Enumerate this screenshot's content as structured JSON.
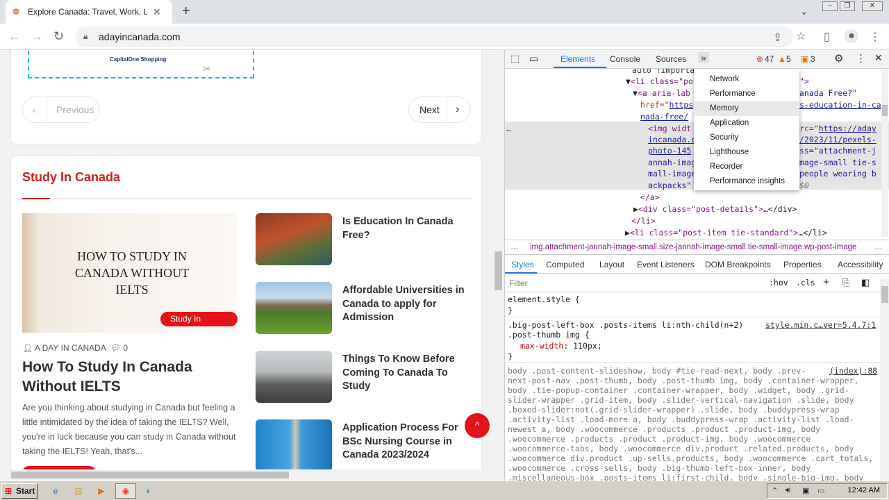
{
  "browser": {
    "tab_title": "Explore Canada: Travel, Work, Live,",
    "tab_close": "✕",
    "new_tab": "+",
    "url": "adayincanada.com"
  },
  "page": {
    "ad_text": "CapitalOne Shopping",
    "pager": {
      "previous": "Previous",
      "next": "Next"
    },
    "section_title": "Study In Canada",
    "featured": {
      "image_text_lines": [
        "HOW TO STUDY IN",
        "CANADA WITHOUT",
        "IELTS"
      ],
      "category_badge": "Study In Canada",
      "author": "A DAY IN CANADA",
      "comments": "0",
      "title": "How To Study In Canada Without IELTS",
      "excerpt": "Are you thinking about studying in Canada but feeling a little intimidated by the idea of taking the IELTS? Well, you're in luck because you can study in Canada without taking the IELTS! Yeah, that's..."
    },
    "posts": [
      {
        "title": "Is Education In Canada Free?"
      },
      {
        "title": "Affordable Universities in Canada to apply for Admission"
      },
      {
        "title": "Things To Know Before Coming To Canada To Study"
      },
      {
        "title": "Application Process For BSc Nursing Course in Canada 2023/2024"
      }
    ]
  },
  "devtools": {
    "tabs": [
      "Elements",
      "Console",
      "Sources"
    ],
    "errors": "47",
    "warnings": "5",
    "issues": "3",
    "overflow_menu": [
      "Network",
      "Performance",
      "Memory",
      "Application",
      "Security",
      "Lighthouse",
      "Recorder",
      "Performance insights"
    ],
    "dom_lines": {
      "l0": "auto !importa",
      "l1a": "<li class=\"po",
      "l1b": "\">",
      "l2a": "<a aria-lab",
      "l2b": "anada Free?\"",
      "l3a": "href=\"",
      "l3b": "https",
      "l3c": "s-education-in-ca",
      "l4": "nada-free/",
      "l5a": "<img widt",
      "l5b": "rc=\"",
      "l5c": "https://aday",
      "l6a": "incanada.c",
      "l6b": "/2023/11/pexels-",
      "l7a": "photo-145",
      "l7b": "ss=\"attachment-j",
      "l8a": "annah-imag",
      "l8b": "mage-small tie-s",
      "l9a": "mall-image",
      "l9b": "people wearing b",
      "l10a": "ackpacks\"",
      "l10b": "$0",
      "l11": "</a>",
      "l12a": "<div class=\"post-details\">",
      "l12b": "…</div>",
      "l13": "</li>",
      "l14a": "<li class=\"post-item  tie-standard\">",
      "l14b": "…</li>"
    },
    "breadcrumb": "img.attachment-jannah-image-small.size-jannah-image-small.tie-small-image.wp-post-image",
    "style_tabs": [
      "Styles",
      "Computed",
      "Layout",
      "Event Listeners",
      "DOM Breakpoints",
      "Properties",
      "Accessibility"
    ],
    "filter_placeholder": "Filter",
    "hov": ":hov",
    "cls": ".cls",
    "styles": {
      "s1": "element.style {",
      "s2": "}",
      "s3": ".big-post-left-box .posts-items li:nth-child(n+2)",
      "s3src": "style.min.c…ver=5.4.7:1",
      "s4": ".post-thumb img {",
      "s5prop": "max-width",
      "s5val": "110px;",
      "s6": "}",
      "s7src": "(index):88",
      "s7": "body .post-content-slideshow, body #tie-read-next, body .prev-",
      "s8": "next-post-nav .post-thumb, body .post-thumb img, body .container-wrapper,",
      "s9": "body .tie-popup-container .container-wrapper, body .widget, body .grid-",
      "s10": "slider-wrapper .grid-item, body .slider-vertical-navigation .slide, body",
      "s11": ".boxed-slider:not(.grid-slider-wrapper) .slide, body .buddypress-wrap",
      "s12": ".activity-list .load-more a, body .buddypress-wrap .activity-list .load-",
      "s13": "newest a, body .woocommerce .products .product .product-img, body",
      "s14": ".woocommerce .products .product .product-img, body .woocommerce",
      "s15": ".woocommerce-tabs, body .woocommerce div.product .related.products, body",
      "s16": ".woocommerce div.product .up-sells.products, body .woocommerce .cart_totals,",
      "s17": ".woocommerce .cross-sells, body .big-thumb-left-box-inner, body",
      "s18": ".miscellaneous-box .posts-items li:first-child, body .single-big-img, body"
    }
  },
  "taskbar": {
    "start": "Start",
    "clock": "12:42 AM"
  }
}
